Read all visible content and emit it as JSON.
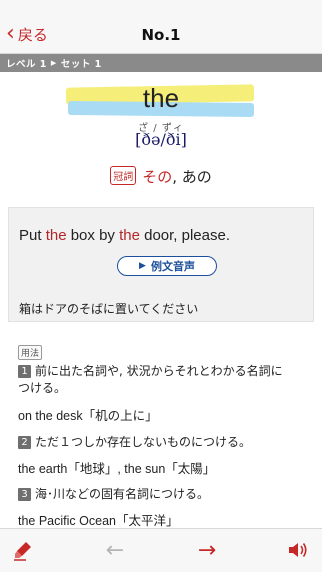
{
  "nav": {
    "back_label": "戻る",
    "title": "No.1"
  },
  "breadcrumb": {
    "level": "レベル 1",
    "set": "セット 1"
  },
  "word": {
    "headword": "the",
    "kana": "ざ / ずィ",
    "ipa": "[ðə/ði]",
    "pos": "冠詞",
    "meaning_main": "その",
    "meaning_rest": ", あの"
  },
  "example": {
    "parts": [
      "Put ",
      "the",
      " box by ",
      "the",
      " door, please."
    ],
    "audio_label": "例文音声",
    "translation": "箱はドアのそばに置いてください"
  },
  "usage": {
    "badge": "用法",
    "items": [
      {
        "num": "1",
        "text_line1": "前に出た名詞や, 状況からそれとわかる名詞に",
        "text_line2": "つける。",
        "example": "on the desk「机の上に」"
      },
      {
        "num": "2",
        "text_line1": "ただ１つしか存在しないものにつける。",
        "example": "the earth「地球」, the sun「太陽」"
      },
      {
        "num": "3",
        "text_line1": "海･川などの固有名詞につける。",
        "example": "the Pacific Ocean「太平洋」"
      }
    ]
  },
  "toolbar": {
    "marker_icon": "highlighter-icon",
    "prev_icon": "arrow-left-icon",
    "next_icon": "arrow-right-icon",
    "sound_icon": "speaker-icon"
  },
  "colors": {
    "accent": "#c62828",
    "link_blue": "#1d4f9c",
    "highlight_yellow": "#f5ef7a",
    "highlight_blue": "#a9dcf4"
  }
}
